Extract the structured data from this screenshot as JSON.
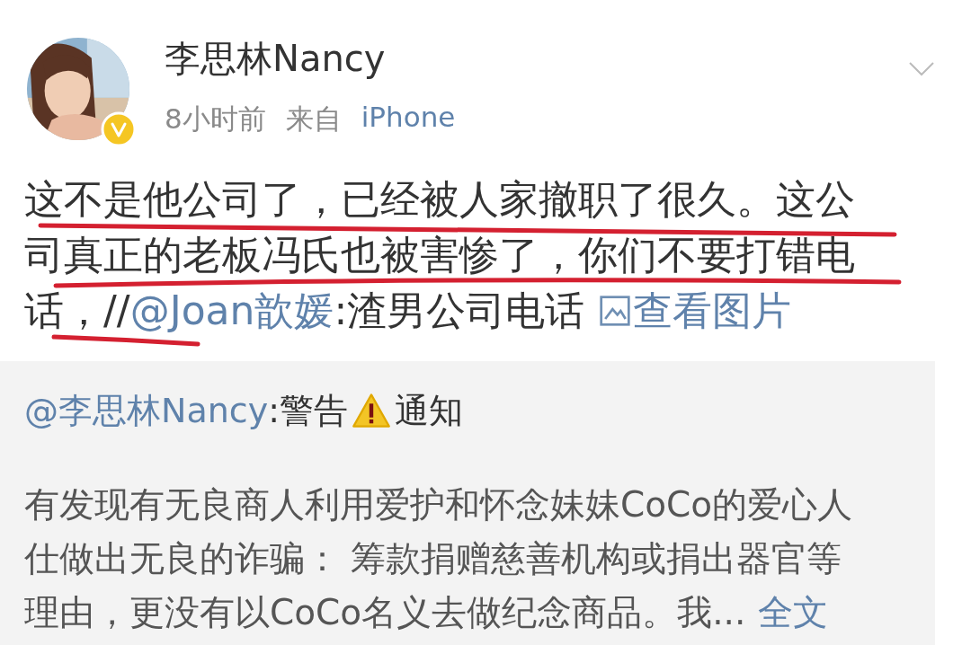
{
  "post": {
    "author": "李思林Nancy",
    "time": "8小时前",
    "source_prefix": "来自",
    "source": "iPhone",
    "text_lines": [
      "这不是他公司了，已经被人家撤职了很久。这公",
      "司真正的老板冯氏也被害惨了，你们不要打错电"
    ],
    "last_line": {
      "text": "话，//",
      "mention": "@Joan歆媛",
      "after": ":渣男公司电话",
      "link": "查看图片"
    }
  },
  "repost": {
    "mention": "@李思林Nancy",
    "title_before": ":警告",
    "title_after": "通知",
    "lines": [
      "有发现有无良商人利用爱护和怀念妹妹CoCo的爱心人",
      "仕做出无良的诈骗： 筹款捐赠慈善机构或捐出器官等",
      "理由，更没有以CoCo名义去做纪念商品。我..."
    ],
    "more": "全文"
  }
}
